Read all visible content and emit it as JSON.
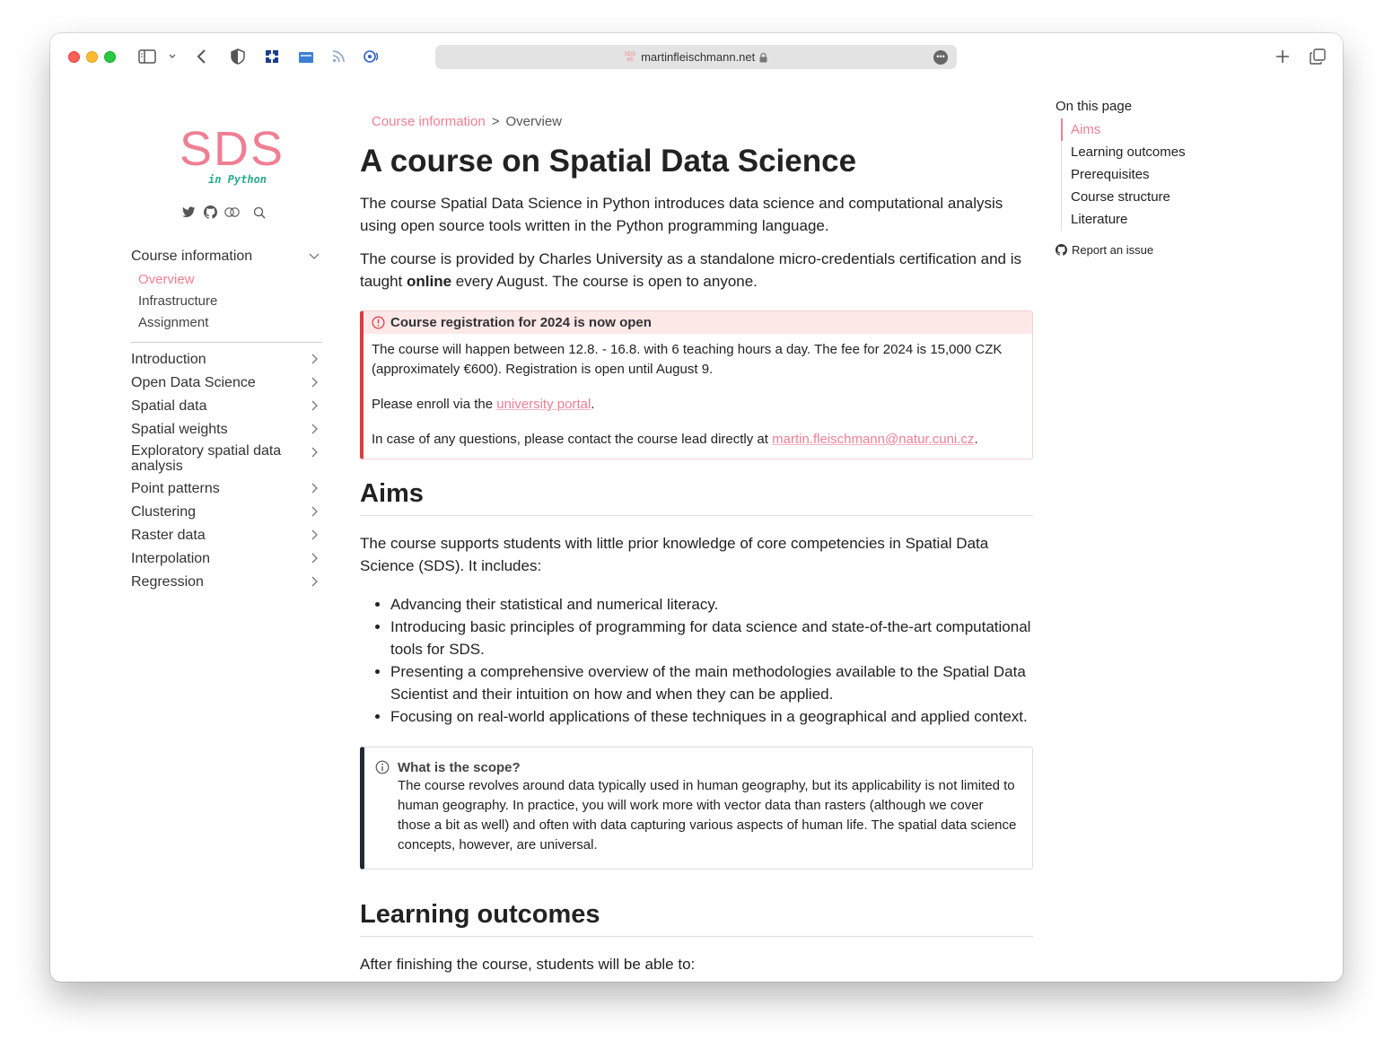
{
  "browser": {
    "url": "martinfleischmann.net",
    "favicon_text": "SDS 4S"
  },
  "sidebar": {
    "logo_main": "SDS",
    "logo_sub": "in Python",
    "section_title": "Course information",
    "sub_items": [
      {
        "label": "Overview",
        "active": true
      },
      {
        "label": "Infrastructure",
        "active": false
      },
      {
        "label": "Assignment",
        "active": false
      }
    ],
    "items": [
      {
        "label": "Introduction"
      },
      {
        "label": "Open Data Science"
      },
      {
        "label": "Spatial data"
      },
      {
        "label": "Spatial weights"
      },
      {
        "label": "Exploratory spatial data analysis"
      },
      {
        "label": "Point patterns"
      },
      {
        "label": "Clustering"
      },
      {
        "label": "Raster data"
      },
      {
        "label": "Interpolation"
      },
      {
        "label": "Regression"
      }
    ]
  },
  "breadcrumb": {
    "parent": "Course information",
    "separator": ">",
    "current": "Overview"
  },
  "main": {
    "title": "A course on Spatial Data Science",
    "intro_1": "The course Spatial Data Science in Python introduces data science and computational analysis using open source tools written in the Python programming language.",
    "intro_2_before": "The course is provided by Charles University as a standalone micro-credentials certification and is taught ",
    "intro_2_bold": "online",
    "intro_2_after": " every August. The course is open to anyone.",
    "callout": {
      "title": "Course registration for 2024 is now open",
      "p1": "The course will happen between 12.8. - 16.8. with 6 teaching hours a day. The fee for 2024 is 15,000 CZK (approximately €600). Registration is open until August 9.",
      "p2_before": "Please enroll via the ",
      "p2_link": "university portal",
      "p2_after": ".",
      "p3_before": "In case of any questions, please contact the course lead directly at ",
      "p3_link": "martin.fleischmann@natur.cuni.cz",
      "p3_after": "."
    },
    "aims_heading": "Aims",
    "aims_intro": "The course supports students with little prior knowledge of core competencies in Spatial Data Science (SDS). It includes:",
    "aims_list": [
      "Advancing their statistical and numerical literacy.",
      "Introducing basic principles of programming for data science and state-of-the-art computational tools for SDS.",
      "Presenting a comprehensive overview of the main methodologies available to the Spatial Data Scientist and their intuition on how and when they can be applied.",
      "Focusing on real-world applications of these techniques in a geographical and applied context."
    ],
    "scope": {
      "title": "What is the scope?",
      "body": "The course revolves around data typically used in human geography, but its applicability is not limited to human geography. In practice, you will work more with vector data than rasters (although we cover those a bit as well) and often with data capturing various aspects of human life. The spatial data science concepts, however, are universal."
    },
    "outcomes_heading": "Learning outcomes",
    "outcomes_intro": "After finishing the course, students will be able to:"
  },
  "toc": {
    "heading": "On this page",
    "items": [
      {
        "label": "Aims",
        "active": true
      },
      {
        "label": "Learning outcomes",
        "active": false
      },
      {
        "label": "Prerequisites",
        "active": false
      },
      {
        "label": "Course structure",
        "active": false
      },
      {
        "label": "Literature",
        "active": false
      }
    ],
    "report_issue": "Report an issue"
  },
  "colors": {
    "accent": "#f07f93",
    "logo_sub": "#2aab8f",
    "warning_border": "#e0393e",
    "note_border": "#1f2a36"
  }
}
